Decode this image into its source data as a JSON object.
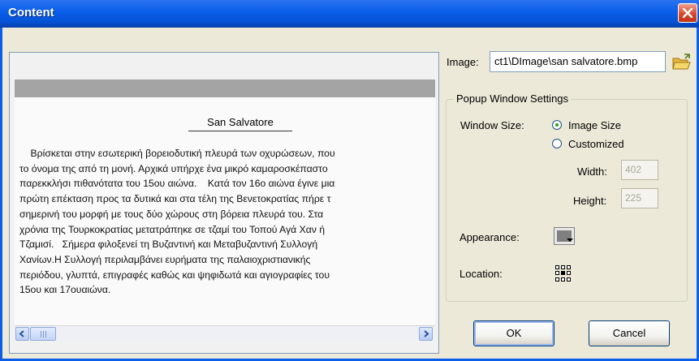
{
  "window": {
    "title": "Content"
  },
  "preview": {
    "heading": "San Salvatore",
    "paragraph": "    Βρίσκεται στην εσωτερική βορειοδυτική πλευρά των οχυρώσεων, που\nτο όνομα της από τη μονή. Αρχικά υπήρχε ένα μικρό καμαροσκέπαστο\nπαρεκκλήσι πιθανότατα του 15ου αιώνα.    Κατά τον 16ο αιώνα έγινε μια\nπρώτη επέκταση προς τα δυτικά και στα τέλη της Βενετοκρατίας πήρε τ\nσημερινή του μορφή με τους δύο χώρους στη βόρεια πλευρά του. Στα\nχρόνια της Τουρκοκρατίας μετατράπηκε σε τζαμί του Τοπού Αγά Χαν ή\nΤζαμισί.   Σήμερα φιλοξενεί τη Βυζαντινή και Μεταβυζαντινή Συλλογή\nΧανίων.Η Συλλογή περιλαμβάνει ευρήματα της παλαιοχριστιανικής\nπεριόδου, γλυπτά, επιγραφές καθώς και ψηφιδωτά και αγιογραφίες του\n15ου και 17ουαιώνα."
  },
  "image": {
    "label": "Image:",
    "path": "ct1\\DImage\\san salvatore.bmp",
    "browse_icon": "folder-open-icon"
  },
  "popup": {
    "group_label": "Popup Window Settings",
    "window_size_label": "Window Size:",
    "options": [
      {
        "label": "Image Size",
        "selected": true
      },
      {
        "label": "Customized",
        "selected": false
      }
    ],
    "width_label": "Width:",
    "width_value": "402",
    "height_label": "Height:",
    "height_value": "225",
    "appearance_label": "Appearance:",
    "appearance_color": "#808080",
    "location_label": "Location:",
    "location_icon": "position-grid-icon"
  },
  "buttons": {
    "ok": "OK",
    "cancel": "Cancel"
  }
}
